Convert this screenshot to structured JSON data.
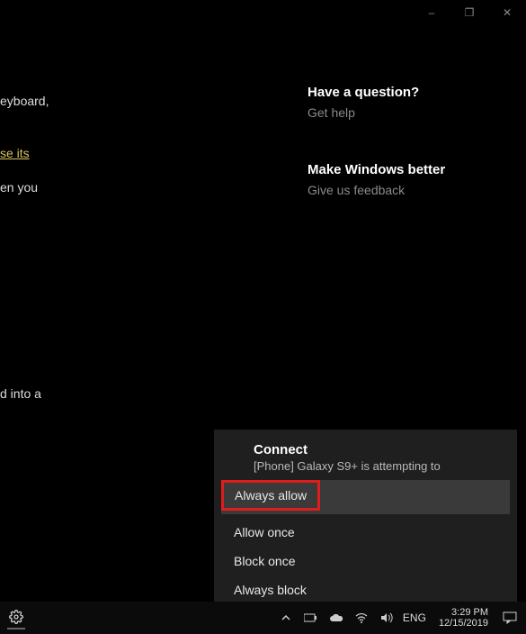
{
  "window_controls": {
    "minimize": "–",
    "maximize": "❐",
    "close": "✕"
  },
  "fragments": {
    "keyboard": "eyboard,",
    "link": "se its",
    "when": "en you",
    "into": "d into a"
  },
  "right": {
    "question": {
      "heading": "Have a question?",
      "link": "Get help"
    },
    "feedback": {
      "heading": "Make Windows better",
      "link": "Give us feedback"
    }
  },
  "toast": {
    "title": "Connect",
    "subtitle": "[Phone] Galaxy S9+ is attempting to",
    "options": {
      "always_allow": "Always allow",
      "allow_once": "Allow once",
      "block_once": "Block once",
      "always_block": "Always block"
    }
  },
  "taskbar": {
    "lang": "ENG",
    "time": "3:29 PM",
    "date": "12/15/2019"
  }
}
